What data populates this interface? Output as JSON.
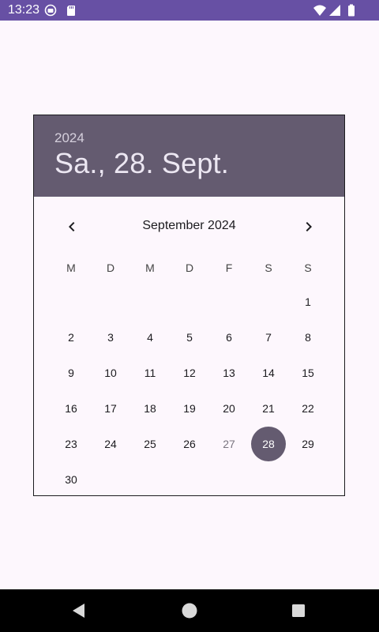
{
  "status_bar": {
    "time": "13:23",
    "icons": [
      "notification-icon",
      "sd-card-icon",
      "wifi-icon",
      "signal-icon",
      "battery-icon"
    ],
    "color": "#6750a4"
  },
  "dialog": {
    "year": "2024",
    "selected_date": "Sa., 28. Sept.",
    "month_title": "September 2024",
    "prev_icon": "chevron-left-icon",
    "next_icon": "chevron-right-icon",
    "weekdays": [
      "M",
      "D",
      "M",
      "D",
      "F",
      "S",
      "S"
    ],
    "days": [
      "1",
      "2",
      "3",
      "4",
      "5",
      "6",
      "7",
      "8",
      "9",
      "10",
      "11",
      "12",
      "13",
      "14",
      "15",
      "16",
      "17",
      "18",
      "19",
      "20",
      "21",
      "22",
      "23",
      "24",
      "25",
      "26",
      "27",
      "28",
      "29",
      "30"
    ],
    "first_weekday_index": 6,
    "today": "27",
    "selected": "28",
    "accent_color": "#645b70"
  },
  "nav_bar": {
    "buttons": [
      "back-icon",
      "home-icon",
      "recents-icon"
    ]
  }
}
